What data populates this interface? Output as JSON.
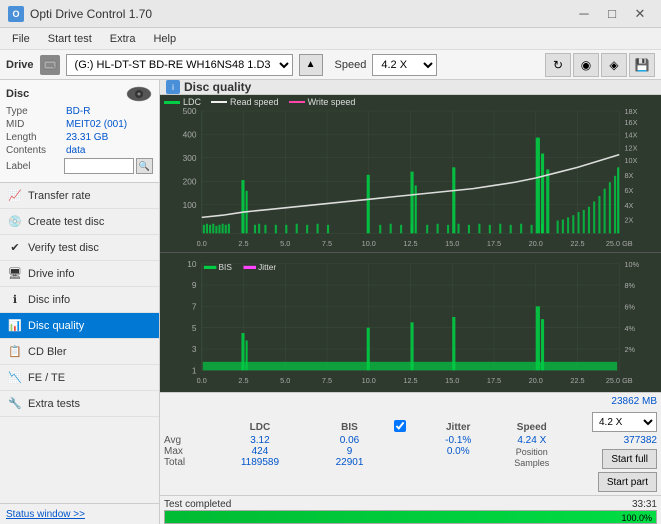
{
  "titlebar": {
    "title": "Opti Drive Control 1.70",
    "min_btn": "─",
    "max_btn": "□",
    "close_btn": "✕"
  },
  "menubar": {
    "items": [
      "File",
      "Start test",
      "Extra",
      "Help"
    ]
  },
  "drivebar": {
    "label": "Drive",
    "drive_value": "(G:)  HL-DT-ST BD-RE  WH16NS48 1.D3",
    "speed_label": "Speed",
    "speed_value": "4.2 X"
  },
  "disc": {
    "type_label": "Type",
    "type_value": "BD-R",
    "mid_label": "MID",
    "mid_value": "MEIT02 (001)",
    "length_label": "Length",
    "length_value": "23.31 GB",
    "contents_label": "Contents",
    "contents_value": "data",
    "label_label": "Label",
    "label_value": ""
  },
  "nav": {
    "items": [
      {
        "id": "transfer-rate",
        "label": "Transfer rate",
        "icon": "📈"
      },
      {
        "id": "create-test-disc",
        "label": "Create test disc",
        "icon": "💿"
      },
      {
        "id": "verify-test-disc",
        "label": "Verify test disc",
        "icon": "✔"
      },
      {
        "id": "drive-info",
        "label": "Drive info",
        "icon": "🖥"
      },
      {
        "id": "disc-info",
        "label": "Disc info",
        "icon": "ℹ"
      },
      {
        "id": "disc-quality",
        "label": "Disc quality",
        "icon": "📊",
        "active": true
      },
      {
        "id": "cd-bler",
        "label": "CD Bler",
        "icon": "📋"
      },
      {
        "id": "fe-te",
        "label": "FE / TE",
        "icon": "📉"
      },
      {
        "id": "extra-tests",
        "label": "Extra tests",
        "icon": "🔧"
      }
    ]
  },
  "chart": {
    "title": "Disc quality",
    "top_legend": {
      "ldc_label": "LDC",
      "read_speed_label": "Read speed",
      "write_speed_label": "Write speed"
    },
    "top_y_left_max": "500",
    "top_y_right_labels": [
      "18X",
      "16X",
      "14X",
      "12X",
      "10X",
      "8X",
      "6X",
      "4X",
      "2X"
    ],
    "top_x_labels": [
      "0.0",
      "2.5",
      "5.0",
      "7.5",
      "10.0",
      "12.5",
      "15.0",
      "17.5",
      "20.0",
      "22.5",
      "25.0 GB"
    ],
    "bottom_legend": {
      "bis_label": "BIS",
      "jitter_label": "Jitter"
    },
    "bottom_y_labels": [
      "10",
      "9",
      "8",
      "7",
      "6",
      "5",
      "4",
      "3",
      "2",
      "1"
    ],
    "bottom_y_right_labels": [
      "10%",
      "8%",
      "6%",
      "4%",
      "2%"
    ],
    "bottom_x_labels": [
      "0.0",
      "2.5",
      "5.0",
      "7.5",
      "10.0",
      "12.5",
      "15.0",
      "17.5",
      "20.0",
      "22.5",
      "25.0 GB"
    ]
  },
  "stats": {
    "ldc_header": "LDC",
    "bis_header": "BIS",
    "jitter_header": "Jitter",
    "speed_header": "Speed",
    "jitter_checked": true,
    "avg_label": "Avg",
    "ldc_avg": "3.12",
    "bis_avg": "0.06",
    "jitter_avg": "-0.1%",
    "speed_value": "4.24 X",
    "max_label": "Max",
    "ldc_max": "424",
    "bis_max": "9",
    "jitter_max": "0.0%",
    "position_label": "Position",
    "position_value": "23862 MB",
    "total_label": "Total",
    "ldc_total": "1189589",
    "bis_total": "22901",
    "samples_label": "Samples",
    "samples_value": "377382",
    "speed_select": "4.2 X",
    "start_full_btn": "Start full",
    "start_part_btn": "Start part"
  },
  "status": {
    "window_btn": "Status window >>",
    "status_text": "Test completed",
    "progress_pct": "100.0%",
    "time": "33:31"
  },
  "colors": {
    "ldc_color": "#00cc44",
    "bis_color": "#00cc44",
    "read_speed_color": "#ffffff",
    "jitter_color": "#ff44ff",
    "chart_bg": "#2d3a2d",
    "grid_color": "#3a4a3a",
    "accent": "#0078d4"
  }
}
